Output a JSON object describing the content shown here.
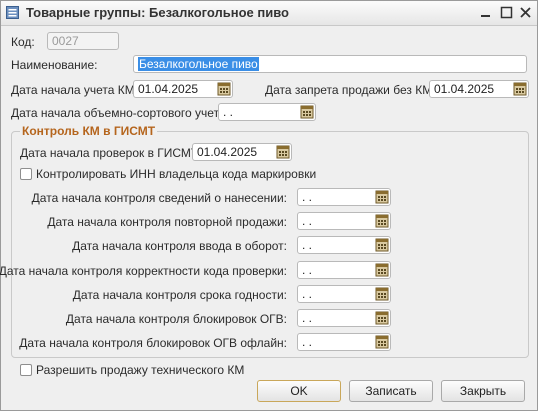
{
  "window": {
    "title": "Товарные группы: Безалкогольное пиво",
    "controls": [
      "▭",
      "☐",
      "✕"
    ]
  },
  "form": {
    "code_label": "Код:",
    "code_value": "0027",
    "name_label": "Наименование:",
    "name_value": "Безалкогольное пиво",
    "km_start_label": "Дата начала учета КМ:",
    "km_start_value": "01.04.2025",
    "ban_label": "Дата запрета продажи без КМ:",
    "ban_value": "01.04.2025",
    "volume_label": "Дата начала объемно-сортового учета:",
    "volume_value": ". ."
  },
  "gismt": {
    "group_title": "Контроль КМ в ГИСМТ",
    "check_start_label": "Дата начала проверок в ГИСМТ:",
    "check_start_value": "01.04.2025",
    "inn_label": "Контролировать ИНН владельца кода маркировки",
    "rows": [
      {
        "label": "Дата начала контроля сведений о нанесении:",
        "value": ". ."
      },
      {
        "label": "Дата начала контроля повторной продажи:",
        "value": ". ."
      },
      {
        "label": "Дата начала контроля ввода в оборот:",
        "value": ". ."
      },
      {
        "label": "Дата начала контроля корректности кода проверки:",
        "value": ". ."
      },
      {
        "label": "Дата начала контроля срока годности:",
        "value": ". ."
      },
      {
        "label": "Дата начала контроля блокировок ОГВ:",
        "value": ". ."
      },
      {
        "label": "Дата начала контроля блокировок ОГВ офлайн:",
        "value": ". ."
      }
    ]
  },
  "footer": {
    "allow_tech_label": "Разрешить продажу технического КМ",
    "ok": "OK",
    "save": "Записать",
    "close": "Закрыть"
  },
  "colors": {
    "group_title": "#b5651d",
    "selection": "#3a8ee6"
  },
  "icons": {
    "calendar": "calendar-icon",
    "title": "catalog-icon"
  }
}
